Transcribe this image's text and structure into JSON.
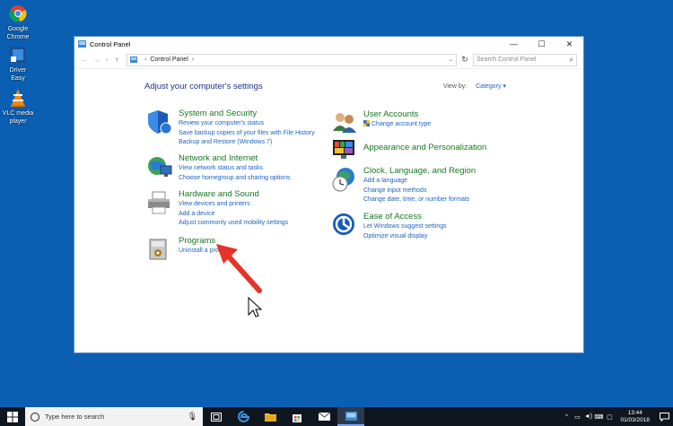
{
  "desktop": {
    "icons": [
      {
        "label_line1": "Google",
        "label_line2": "Chrome",
        "icon": "chrome-icon"
      },
      {
        "label_line1": "Driver Easy",
        "label_line2": "",
        "icon": "driver-easy-icon"
      },
      {
        "label_line1": "VLC media",
        "label_line2": "player",
        "icon": "vlc-icon"
      }
    ]
  },
  "window": {
    "title": "Control Panel",
    "controls": {
      "minimize": "—",
      "maximize": "☐",
      "close": "✕"
    },
    "address": {
      "root": "Control Panel"
    },
    "search_placeholder": "Search Control Panel"
  },
  "content": {
    "title": "Adjust your computer's settings",
    "view_by_label": "View by:",
    "view_by_value": "Category ▾",
    "left": [
      {
        "heading": "System and Security",
        "icon": "shield-icon",
        "links": [
          "Review your computer's status",
          "Save backup copies of your files with File History",
          "Backup and Restore (Windows 7)"
        ]
      },
      {
        "heading": "Network and Internet",
        "icon": "globe-network-icon",
        "links": [
          "View network status and tasks",
          "Choose homegroup and sharing options"
        ]
      },
      {
        "heading": "Hardware and Sound",
        "icon": "printer-icon",
        "links": [
          "View devices and printers",
          "Add a device",
          "Adjust commonly used mobility settings"
        ]
      },
      {
        "heading": "Programs",
        "icon": "programs-icon",
        "links": [
          "Uninstall a pro"
        ]
      }
    ],
    "right": [
      {
        "heading": "User Accounts",
        "icon": "users-icon",
        "links": [
          "Change account type"
        ]
      },
      {
        "heading": "Appearance and Personalization",
        "icon": "appearance-icon",
        "links": []
      },
      {
        "heading": "Clock, Language, and Region",
        "icon": "clock-icon",
        "links": [
          "Add a language",
          "Change input methods",
          "Change date, time, or number formats"
        ]
      },
      {
        "heading": "Ease of Access",
        "icon": "ease-of-access-icon",
        "links": [
          "Let Windows suggest settings",
          "Optimize visual display"
        ]
      }
    ]
  },
  "taskbar": {
    "search_text": "Type here to search",
    "time": "13:44",
    "date": "01/03/2018"
  },
  "colors": {
    "desktop": "#0a5fb3",
    "heading_green": "#16791f",
    "link_blue": "#1c63c0",
    "title_blue": "#1e3287",
    "arrow_red": "#e53329"
  }
}
